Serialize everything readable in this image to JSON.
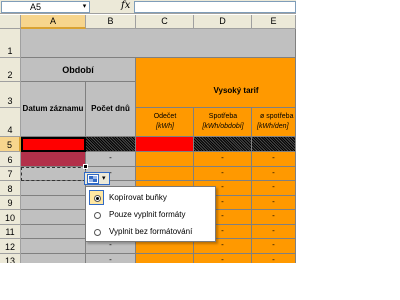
{
  "formula_bar": {
    "name_box": "A5",
    "fx_icon": "fx"
  },
  "columns": [
    "A",
    "B",
    "C",
    "D",
    "E"
  ],
  "rows": [
    "1",
    "2",
    "3",
    "4",
    "5",
    "6",
    "7",
    "8",
    "9",
    "10",
    "11",
    "12",
    "13"
  ],
  "header": {
    "obdobi": "Období",
    "datum_zaznamu": "Datum záznamu",
    "pocet_dnu": "Počet dnů",
    "vysoky_tarif": "Vysoký tarif",
    "odecet": "Odečet",
    "odecet_unit": "[kWh]",
    "spotreba": "Spotřeba",
    "spotreba_unit": "[kWh/období]",
    "prumer_spotreba": "ø spotřeba",
    "prumer_unit": "[kWh/den]"
  },
  "dash": "-",
  "smart_tag": {
    "icon": "paste-options-icon",
    "arrow": "▾"
  },
  "paste_menu": {
    "items": [
      {
        "label": "Kopírovat buňky",
        "selected": true
      },
      {
        "label": "Pouze vyplnit formáty",
        "selected": false
      },
      {
        "label": "Vyplnit bez formátování",
        "selected": false
      }
    ]
  },
  "colors": {
    "orange": "#ff9900",
    "gray": "#c0c0c0",
    "red": "#ff0000",
    "dark_red": "#b3304a",
    "header_highlight": "#f7d58d"
  }
}
